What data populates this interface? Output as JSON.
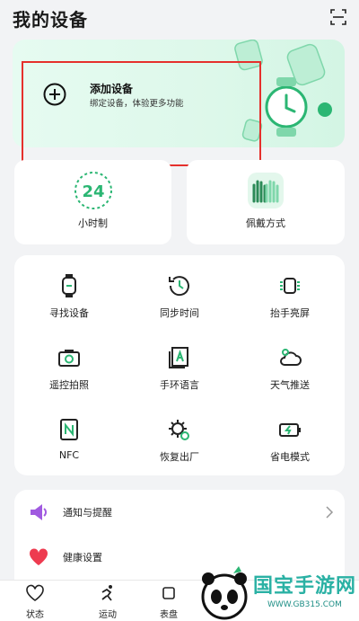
{
  "header": {
    "title": "我的设备",
    "scan_icon": "scan-icon"
  },
  "add_device": {
    "title": "添加设备",
    "subtitle": "绑定设备，体验更多功能"
  },
  "quick_tiles": [
    {
      "label": "小时制",
      "value": "24"
    },
    {
      "label": "佩戴方式"
    }
  ],
  "features": [
    {
      "label": "寻找设备",
      "icon": "watch-icon"
    },
    {
      "label": "同步时间",
      "icon": "clock-sync-icon"
    },
    {
      "label": "抬手亮屏",
      "icon": "raise-wrist-icon"
    },
    {
      "label": "遥控拍照",
      "icon": "camera-icon"
    },
    {
      "label": "手环语言",
      "icon": "language-icon"
    },
    {
      "label": "天气推送",
      "icon": "weather-icon"
    },
    {
      "label": "NFC",
      "icon": "nfc-icon"
    },
    {
      "label": "恢复出厂",
      "icon": "factory-reset-icon"
    },
    {
      "label": "省电模式",
      "icon": "battery-icon"
    }
  ],
  "settings_list": [
    {
      "label": "通知与提醒",
      "icon": "speaker-icon"
    },
    {
      "label": "健康设置",
      "icon": "heart-icon"
    }
  ],
  "tabs": [
    {
      "label": "状态"
    },
    {
      "label": "运动"
    },
    {
      "label": "表盘"
    }
  ],
  "watermark": {
    "text": "国宝手游网",
    "url": "WWW.GB315.COM"
  },
  "colors": {
    "accent": "#2bb673",
    "highlight": "#e5302c",
    "card_bg": "#ddf8ea"
  }
}
